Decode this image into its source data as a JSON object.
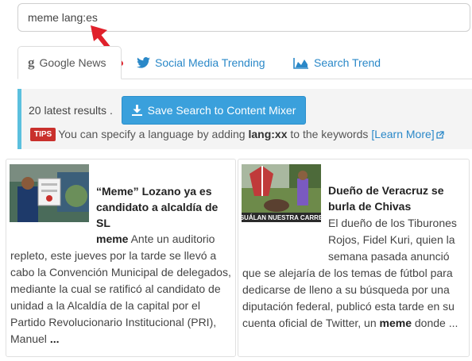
{
  "search": {
    "value": "meme lang:es"
  },
  "tabs": [
    {
      "label": "Google News",
      "icon": "google-g-icon",
      "active": true
    },
    {
      "label": "Social Media Trending",
      "icon": "twitter-bird-icon",
      "active": false
    },
    {
      "label": "Search Trend",
      "icon": "area-chart-icon",
      "active": false
    }
  ],
  "results": {
    "count_text": "20 latest results .",
    "save_button": "Save Search to Content Mixer",
    "tips_badge": "TIPS",
    "tips_text_pre": "You can specify a language by adding ",
    "tips_keyword": "lang:xx",
    "tips_text_post": " to the keywords ",
    "learn_more": "[Learn More]"
  },
  "articles": [
    {
      "title": "“Meme” Lozano ya es candidato a alcaldía de SL",
      "keyword": "meme",
      "snippet_line1": " Ante un auditorio repleto, este jueves por la tarde se llevó a cabo la Convención Municipal de delegados, mediante la cual se ratificó al candidato de unidad a la Alcaldía de la capital por el Partido Revolucionario Institucional (PRI), Manuel ",
      "ellipsis": "..."
    },
    {
      "title": "Dueño de Veracruz se burla de Chivas",
      "snippet_a": "El dueño de los Tiburones Rojos, Fidel Kuri, quien la semana pasada anunció",
      "snippet_b": " que se alejaría de los temas de fútbol para dedicarse de lleno a su búsqueda por una diputación federal, publicó esta tarde en su cuenta oficial de Twitter, un ",
      "keyword": "meme",
      "snippet_end": " donde ...",
      "thumb_caption": "SUÁLAN NUESTRA CARRE"
    }
  ],
  "colors": {
    "accent": "#2a88c8",
    "button": "#3aa0dc",
    "tips": "#c9302c",
    "info_border": "#5bc0de",
    "arrow": "#e0212b"
  }
}
